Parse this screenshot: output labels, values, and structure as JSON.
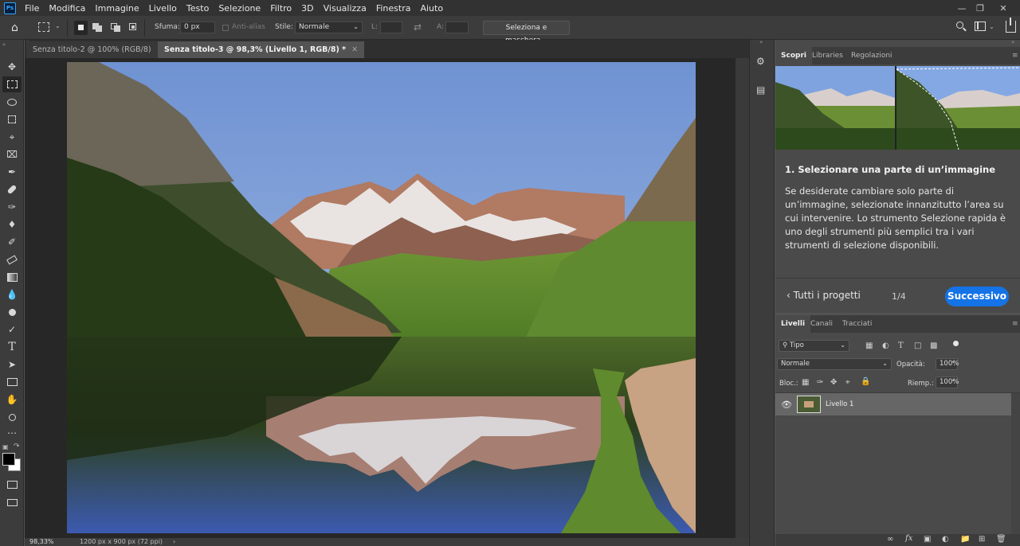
{
  "app": {
    "logo_text": "Ps"
  },
  "menu": [
    "File",
    "Modifica",
    "Immagine",
    "Livello",
    "Testo",
    "Selezione",
    "Filtro",
    "3D",
    "Visualizza",
    "Finestra",
    "Aiuto"
  ],
  "options": {
    "feather_label": "Sfuma:",
    "feather_value": "0 px",
    "antialias_label": "Anti-alias",
    "style_label": "Stile:",
    "style_value": "Normale",
    "width_label": "L:",
    "height_label": "A:",
    "select_mask_button": "Seleziona e maschera..."
  },
  "doc_tabs": [
    {
      "label": "Senza titolo-2 @ 100% (RGB/8)",
      "active": false
    },
    {
      "label": "Senza titolo-3 @ 98,3% (Livello 1, RGB/8) *",
      "active": true
    }
  ],
  "status": {
    "zoom": "98,33%",
    "doc_info": "1200 px x 900 px (72 ppi)"
  },
  "learn_panel": {
    "tabs": [
      "Scopri",
      "Libraries",
      "Regolazioni"
    ],
    "step_title": "1.  Selezionare una parte di un’immagine",
    "step_body": "Se desiderate cambiare solo parte di un’immagine, selezionate innanzitutto l’area su cui intervenire. Lo strumento Selezione rapida è uno degli strumenti più semplici tra i vari strumenti di selezione disponibili.",
    "back_link": "Tutti i progetti",
    "progress": "1/4",
    "next_button": "Successivo"
  },
  "layers_panel": {
    "tabs": [
      "Livelli",
      "Canali",
      "Tracciati"
    ],
    "filter_kind": "Tipo",
    "blend_mode": "Normale",
    "opacity_label": "Opacità:",
    "opacity_value": "100%",
    "lock_label": "Bloc.:",
    "fill_label": "Riemp.:",
    "fill_value": "100%",
    "layers": [
      {
        "name": "Livello 1",
        "visible": true
      }
    ]
  },
  "colors": {
    "accent": "#1473e6",
    "panel": "#4a4a4a",
    "canvas_bg": "#272727"
  }
}
